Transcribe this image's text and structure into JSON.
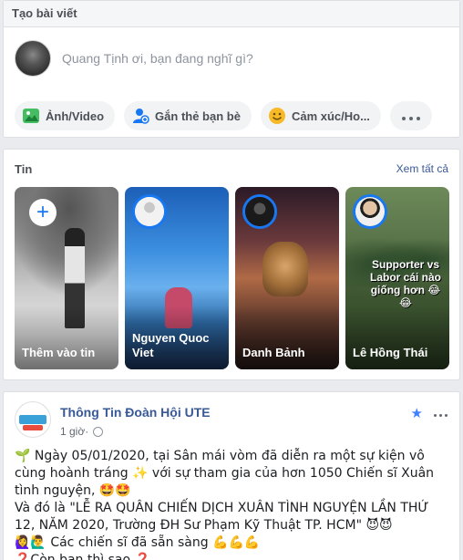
{
  "composer": {
    "title": "Tạo bài viết",
    "placeholder": "Quang Tịnh ơi, bạn đang nghĩ gì?",
    "actions": [
      {
        "label": "Ảnh/Video",
        "icon": "photo-icon"
      },
      {
        "label": "Gắn thẻ bạn bè",
        "icon": "tag-friends-icon"
      },
      {
        "label": "Cảm xúc/Ho...",
        "icon": "feeling-icon"
      }
    ]
  },
  "stories": {
    "title": "Tin",
    "see_all": "Xem tất cả",
    "items": [
      {
        "name": "Thêm vào tin"
      },
      {
        "name": "Nguyen Quoc Viet"
      },
      {
        "name": "Danh Bảnh"
      },
      {
        "name": "Lê Hồng Thái",
        "overlay_text": "Supporter vs Labor cái nào giống hơn 😂😂"
      }
    ]
  },
  "post": {
    "page_name": "Thông Tin Đoàn Hội UTE",
    "time": "1 giờ",
    "lines": [
      "🌱 Ngày 05/01/2020, tại Sân mái vòm đã diễn ra một sự kiện vô cùng hoành tráng ✨ với sự tham gia của hơn 1050 Chiến sĩ Xuân tình nguyện, 🤩🤩",
      "Và đó là \"LỄ RA QUÂN CHIẾN DỊCH XUÂN TÌNH NGUYỆN LẦN THỨ 12, NĂM 2020, Trường ĐH Sư Phạm Kỹ Thuật TP. HCM\" 😈😈",
      "🙋‍♀️🙋‍♂️ Các chiến sĩ đã sẵn sàng 💪💪💪",
      "❓Còn bạn thì sao ❓"
    ]
  },
  "colors": {
    "link": "#385898",
    "accent": "#1877f2",
    "page_bg": "#e9ebee"
  }
}
